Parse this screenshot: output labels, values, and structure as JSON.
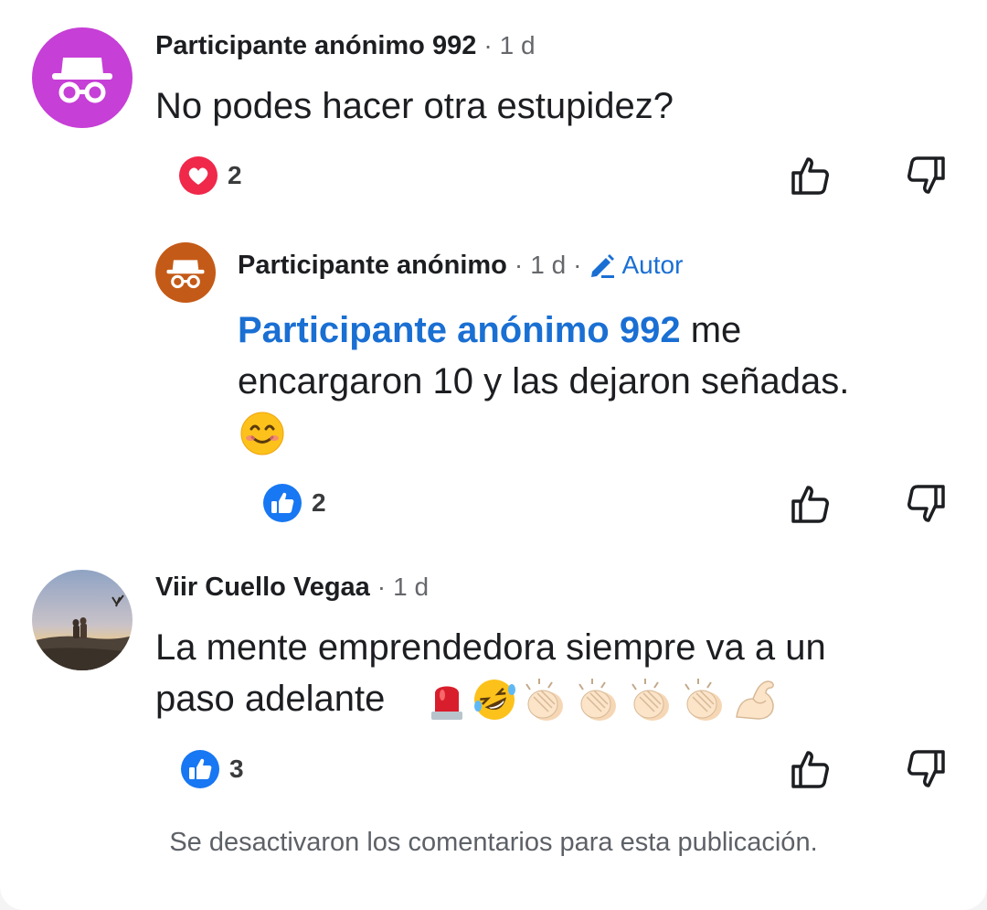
{
  "comments": [
    {
      "author": "Participante anónimo 992",
      "time": "1 d",
      "text": "No podes hacer otra estupidez?",
      "reaction_type": "love",
      "reaction_count": "2"
    },
    {
      "author": "Participante anónimo",
      "time": "1 d",
      "badge": "Autor",
      "mention": "Participante anónimo 992",
      "text_line1_rest": " me",
      "text_line2": "encargaron 10 y las dejaron señadas.",
      "reaction_type": "like",
      "reaction_count": "2"
    },
    {
      "author": "Viir Cuello Vegaa",
      "time": "1 d",
      "text_line1": "La mente emprendedora siempre va a un",
      "text_line2": "paso adelante",
      "reaction_type": "like",
      "reaction_count": "3"
    }
  ],
  "separator": "·",
  "footer": "Se desactivaron los comentarios para esta publicación.",
  "icons": {
    "anon_avatar_1": "incognito-icon",
    "anon_avatar_2": "incognito-icon",
    "love": "heart-reaction-icon",
    "like": "thumbs-up-reaction-icon",
    "upvote": "thumbs-up-outline-icon",
    "downvote": "thumbs-down-outline-icon",
    "author_badge": "pencil-icon"
  },
  "colors": {
    "anon_avatar_1": "#c63fd6",
    "anon_avatar_2": "#c45a17",
    "link": "#1a6fd3",
    "love": "#f0284a",
    "like": "#1877f2"
  }
}
